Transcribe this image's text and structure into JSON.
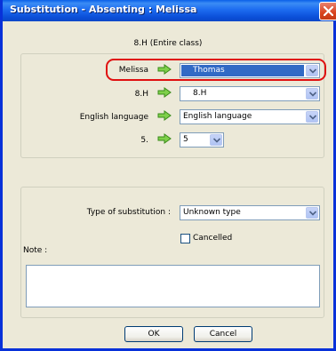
{
  "window": {
    "title": "Substitution - Absenting : Melissa"
  },
  "header": {
    "class_info": "8.H (Entire class)"
  },
  "rows": [
    {
      "label": "Melissa",
      "value": "Thomas"
    },
    {
      "label": "8.H",
      "value": "8.H"
    },
    {
      "label": "English language",
      "value": "English language"
    },
    {
      "label": "5.",
      "value": "5"
    }
  ],
  "substitution": {
    "type_label": "Type of substitution :",
    "type_value": "Unknown type",
    "cancelled_label": "Cancelled",
    "cancelled_checked": false
  },
  "note": {
    "label": "Note :",
    "value": ""
  },
  "buttons": {
    "ok": "OK",
    "cancel": "Cancel"
  },
  "colors": {
    "titlebar": "#0a5fe8",
    "highlight": "#316ac5",
    "annotation": "#e01010",
    "arrow": "#6cc03c"
  },
  "icons": {
    "row_arrow": "green-right-arrow-icon",
    "close": "close-icon",
    "dropdown": "chevron-down-icon"
  }
}
